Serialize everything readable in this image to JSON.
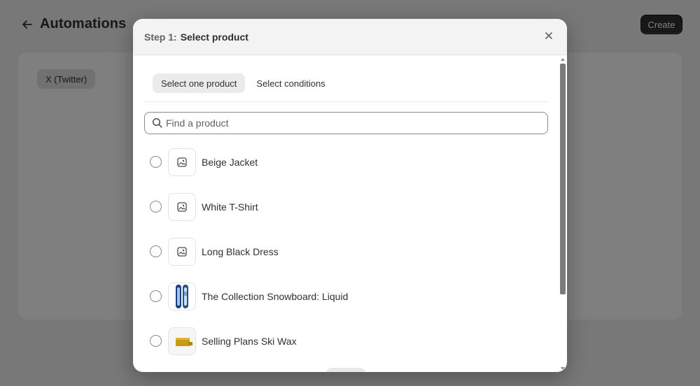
{
  "page": {
    "title": "Automations",
    "create_label": "Create",
    "chip_label": "X (Twitter)"
  },
  "modal": {
    "step_label": "Step 1:",
    "title": "Select product",
    "tabs": [
      {
        "label": "Select one product",
        "active": true
      },
      {
        "label": "Select conditions",
        "active": false
      }
    ],
    "search": {
      "placeholder": "Find a product",
      "value": ""
    },
    "products": [
      {
        "name": "Beige Jacket",
        "thumbnail": "image-placeholder-icon",
        "selected": false
      },
      {
        "name": "White T-Shirt",
        "thumbnail": "image-placeholder-icon",
        "selected": false
      },
      {
        "name": "Long Black Dress",
        "thumbnail": "image-placeholder-icon",
        "selected": false
      },
      {
        "name": "The Collection Snowboard: Liquid",
        "thumbnail": "snowboard-image",
        "selected": false
      },
      {
        "name": "Selling Plans Ski Wax",
        "thumbnail": "ski-wax-image",
        "selected": false
      }
    ]
  },
  "colors": {
    "primary_button": "#303030",
    "overlay": "rgba(0,0,0,0.5)",
    "active_tab": "#ebebeb"
  }
}
